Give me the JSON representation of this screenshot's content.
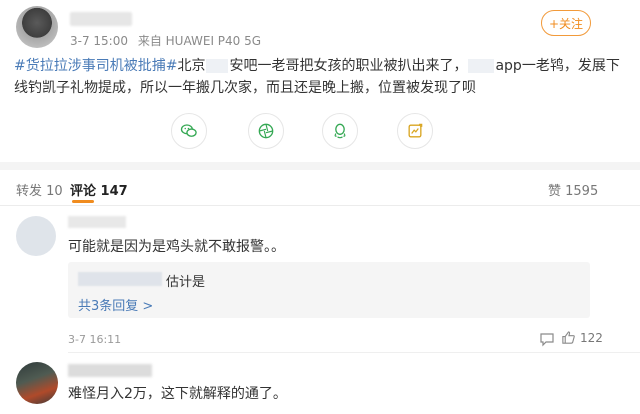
{
  "post": {
    "timestamp": "3-7 15:00",
    "source": "来自 HUAWEI P40 5G",
    "follow_label": "+关注",
    "hashtag": "#货拉拉涉事司机被批捕#",
    "text_part1": "北京",
    "text_part2": "安吧一老哥把女孩的职业被扒出来了，",
    "text_part3": "app一老鸨，发展下",
    "text_line2": "线钓凯子礼物提成，所以一年搬几次家，而且还是晚上搬，位置被发现了呗"
  },
  "share_icons": [
    "wechat-icon",
    "moments-icon",
    "qq-icon",
    "qzone-icon"
  ],
  "tabs": {
    "repost": "转发 10",
    "comments": "评论 147",
    "likes": "赞 1595"
  },
  "comments": [
    {
      "text": "可能就是因为是鸡头就不敢报警。。",
      "reply_text": "估计是",
      "more_replies": "共3条回复 >",
      "date": "3-7 16:11",
      "likes": "122"
    },
    {
      "text": "难怪月入2万，这下就解释的通了。"
    }
  ],
  "colors": {
    "accent": "#f08c1f",
    "link": "#4a7bb7",
    "share_green": "#34a853"
  }
}
